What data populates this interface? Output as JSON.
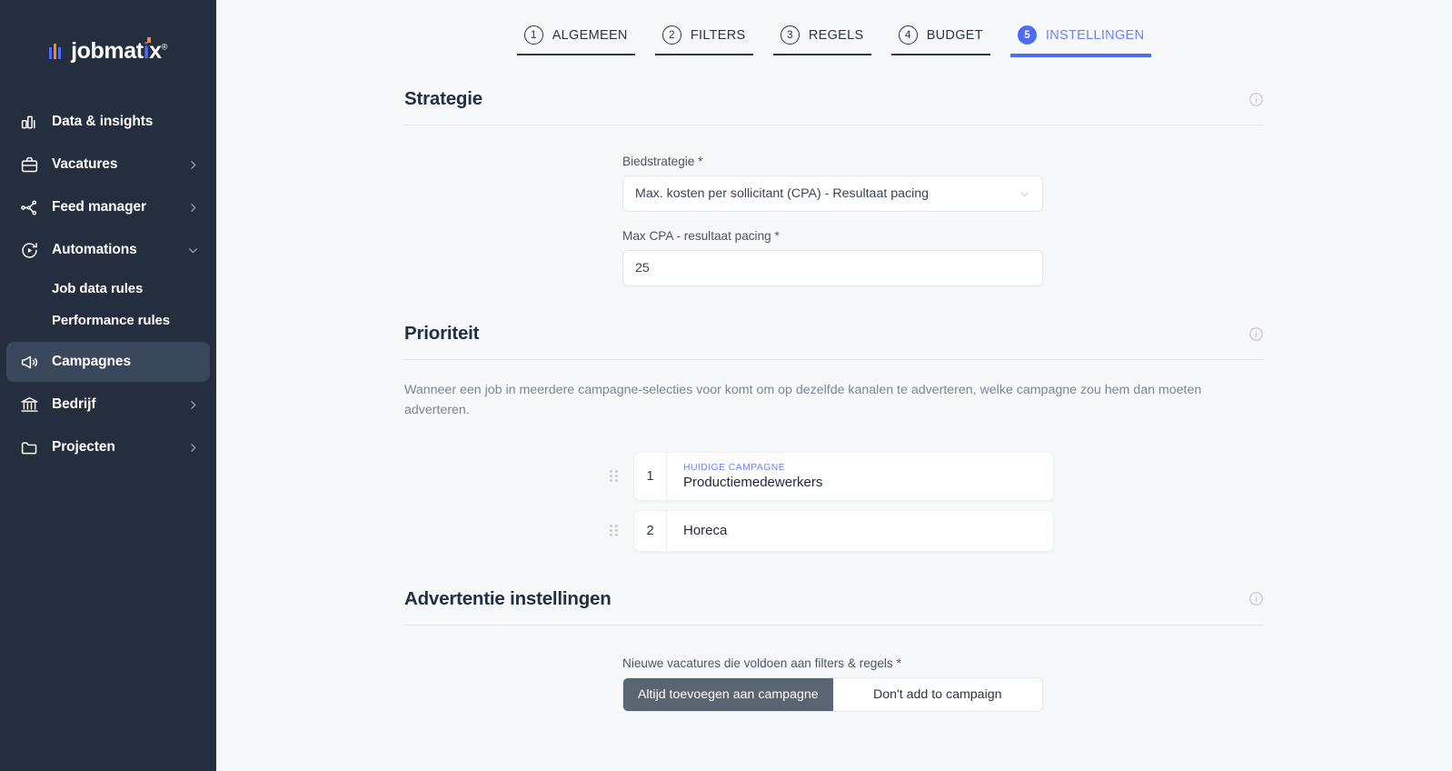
{
  "sidebar": {
    "logo": {
      "name": "jobmatix",
      "mark": "logo-bars-icon",
      "registered": "®"
    },
    "items": [
      {
        "label": "Data & insights",
        "icon": "bar-chart-icon",
        "chevron": false,
        "active": false
      },
      {
        "label": "Vacatures",
        "icon": "briefcase-icon",
        "chevron": "chevron-right-icon",
        "active": false
      },
      {
        "label": "Feed manager",
        "icon": "network-nodes-icon",
        "chevron": "chevron-right-icon",
        "active": false
      },
      {
        "label": "Automations",
        "icon": "automation-refresh-play-icon",
        "chevron": "chevron-down-icon",
        "active": false
      },
      {
        "label": "Campagnes",
        "icon": "megaphone-icon",
        "chevron": false,
        "active": true
      },
      {
        "label": "Bedrijf",
        "icon": "bank-icon",
        "chevron": "chevron-right-icon",
        "active": false
      },
      {
        "label": "Projecten",
        "icon": "folder-icon",
        "chevron": "chevron-right-icon",
        "active": false
      }
    ],
    "sub_items": [
      {
        "label": "Job data rules"
      },
      {
        "label": "Performance rules"
      }
    ]
  },
  "tabs": [
    {
      "num": "1",
      "label": "ALGEMEEN",
      "active": false
    },
    {
      "num": "2",
      "label": "FILTERS",
      "active": false
    },
    {
      "num": "3",
      "label": "REGELS",
      "active": false
    },
    {
      "num": "4",
      "label": "BUDGET",
      "active": false
    },
    {
      "num": "5",
      "label": "INSTELLINGEN",
      "active": true
    }
  ],
  "strategie": {
    "title": "Strategie",
    "bid_strategy_label": "Biedstrategie *",
    "bid_strategy_value": "Max. kosten per sollicitant (CPA) - Resultaat pacing",
    "max_cpa_label": "Max CPA - resultaat pacing *",
    "max_cpa_value": "25"
  },
  "prioriteit": {
    "title": "Prioriteit",
    "description": "Wanneer een job in meerdere campagne-selecties voor komt om op dezelfde kanalen te adverteren, welke campagne zou hem dan moeten adverteren.",
    "items": [
      {
        "num": "1",
        "tag": "HUIDIGE CAMPAGNE",
        "name": "Productiemedewerkers"
      },
      {
        "num": "2",
        "tag": "",
        "name": "Horeca"
      }
    ]
  },
  "advertentie": {
    "title": "Advertentie instellingen",
    "new_jobs_label": "Nieuwe vacatures die voldoen aan filters & regels *",
    "options": [
      {
        "label": "Altijd toevoegen aan campagne",
        "selected": true
      },
      {
        "label": "Don't add to campaign",
        "selected": false
      }
    ]
  },
  "colors": {
    "sidebar_bg": "#252e3e",
    "sidebar_active": "#39475a",
    "accent_blue": "#4f6bf6",
    "accent_orange": "#f08a2e",
    "page_bg": "#f6f8fa",
    "segment_selected": "#5b6572"
  }
}
